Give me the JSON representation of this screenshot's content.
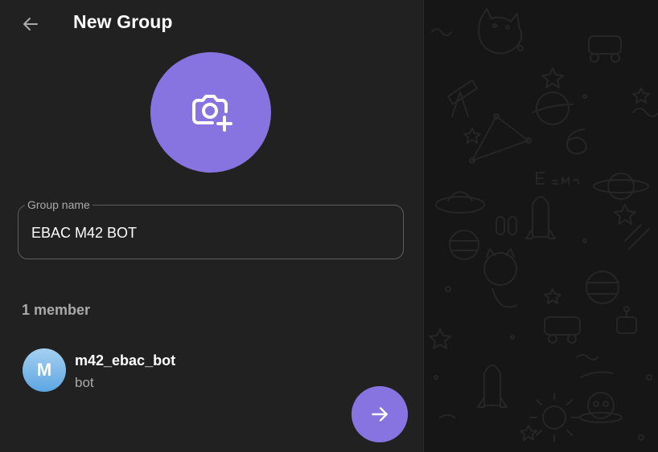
{
  "header": {
    "back_icon": "arrow-left-icon",
    "title": "New Group"
  },
  "avatar_upload": {
    "icon": "camera-add-icon",
    "color": "#8774e1"
  },
  "group_name": {
    "label": "Group name",
    "value": "EBAC M42 BOT"
  },
  "members": {
    "count_label": "1 member",
    "items": [
      {
        "initial": "M",
        "name": "m42_ebac_bot",
        "status": "bot"
      }
    ]
  },
  "next_button": {
    "icon": "arrow-right-icon",
    "color": "#8774e1"
  },
  "background": {
    "pattern": "doodle-pattern"
  }
}
